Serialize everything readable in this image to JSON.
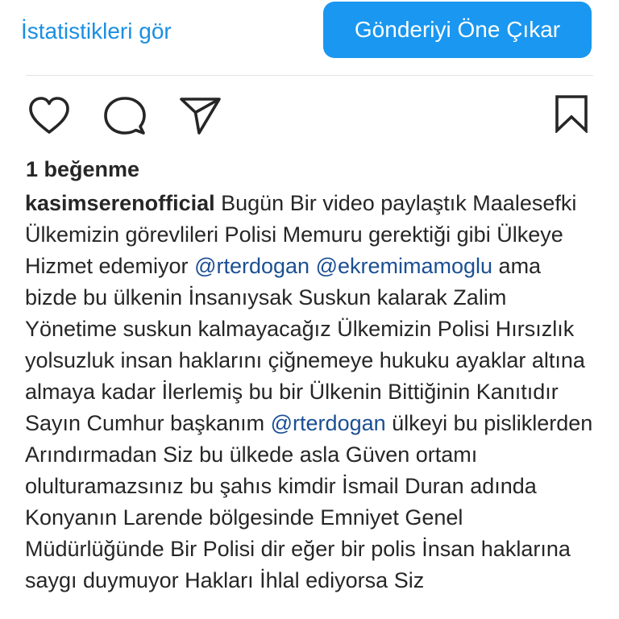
{
  "header": {
    "insights_label": "İstatistikleri gör",
    "boost_label": "Gönderiyi Öne Çıkar"
  },
  "actions": {
    "like_icon": "heart-outline-icon",
    "comment_icon": "comment-bubble-icon",
    "share_icon": "paper-plane-icon",
    "save_icon": "bookmark-icon"
  },
  "post": {
    "likes_text": "1 beğenme",
    "username": "kasimserenofficial",
    "caption": {
      "part1": " Bugün Bir video paylaştık Maalesefki Ülkemizin görevlileri Polisi Memuru gerektiği gibi Ülkeye Hizmet edemiyor ",
      "mention1": "@rterdogan",
      "part2": " ",
      "mention2": "@ekremimamoglu",
      "part3": " ama bizde bu ülkenin İnsanıysak Suskun kalarak Zalim Yönetime suskun kalmayacağız Ülkemizin Polisi Hırsızlık yolsuzluk insan haklarını çiğnemeye hukuku ayaklar altına almaya kadar İlerlemiş bu bir Ülkenin Bittiğinin Kanıtıdır Sayın Cumhur başkanım ",
      "mention3": "@rterdogan",
      "part4": " ülkeyi bu pisliklerden Arındırmadan Siz bu ülkede asla Güven ortamı olulturamazsınız bu şahıs kimdir İsmail Duran adında Konyanın Larende bölgesinde Emniyet Genel Müdürlüğünde Bir Polisi dir eğer bir polis İnsan haklarına saygı duymuyor Hakları İhlal ediyorsa Siz"
    }
  },
  "colors": {
    "link_blue": "#1a8fe3",
    "button_blue": "#1a97f0",
    "mention_blue": "#1b4f93",
    "text": "#262626"
  }
}
